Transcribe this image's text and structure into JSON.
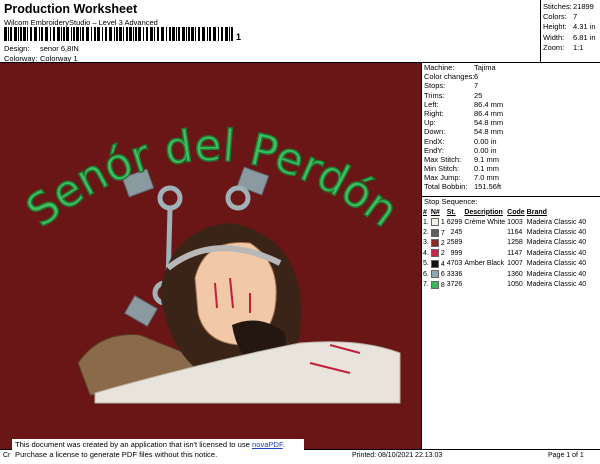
{
  "header": {
    "title": "Production Worksheet",
    "subtitle": "Wilcom EmbroideryStudio – Level 3 Advanced",
    "barcode_suffix": "1"
  },
  "design_info": [
    {
      "label": "Design:",
      "value": "senor 6,8IN"
    },
    {
      "label": "Colorway:",
      "value": "Colorway 1"
    }
  ],
  "stats": [
    {
      "label": "Stitches:",
      "value": "21899"
    },
    {
      "label": "Colors:",
      "value": "7"
    },
    {
      "label": "Height:",
      "value": "4.31 in"
    },
    {
      "label": "Width:",
      "value": "6.81 in"
    },
    {
      "label": "Zoom:",
      "value": "1:1"
    }
  ],
  "design_text": "Senór del Perdón",
  "machine_info": [
    {
      "label": "Machine:",
      "value": "Tajima"
    },
    {
      "label": "Color changes:",
      "value": "6"
    },
    {
      "label": "Stops:",
      "value": "7"
    },
    {
      "label": "Trims:",
      "value": "25"
    },
    {
      "label": "Left:",
      "value": "86.4 mm"
    },
    {
      "label": "Right:",
      "value": "86.4 mm"
    },
    {
      "label": "Up:",
      "value": "54.8 mm"
    },
    {
      "label": "Down:",
      "value": "54.8 mm"
    },
    {
      "label": "EndX:",
      "value": "0.00 in"
    },
    {
      "label": "EndY:",
      "value": "0.00 in"
    },
    {
      "label": "Max Stitch:",
      "value": "9.1 mm"
    },
    {
      "label": "Min Stitch:",
      "value": "0.1 mm"
    },
    {
      "label": "Max Jump:",
      "value": "7.0 mm"
    },
    {
      "label": "Total Bobbin:",
      "value": "151.56ft"
    }
  ],
  "sequence": {
    "title": "Stop Sequence:",
    "headers": [
      "#",
      "N#",
      "St.",
      "Description",
      "Code",
      "Brand"
    ],
    "rows": [
      {
        "n": "1.",
        "nn": "1",
        "color": "#f4f2ea",
        "st": "6299",
        "desc": "Crème White",
        "code": "1003",
        "brand": "Madeira Classic 40"
      },
      {
        "n": "2.",
        "nn": "7",
        "color": "#5e5e5e",
        "st": "245",
        "desc": "",
        "code": "1164",
        "brand": "Madeira Classic 40"
      },
      {
        "n": "3.",
        "nn": "2",
        "color": "#8a2a2a",
        "st": "2589",
        "desc": "",
        "code": "1258",
        "brand": "Madeira Classic 40"
      },
      {
        "n": "4.",
        "nn": "2",
        "color": "#c8244a",
        "st": "999",
        "desc": "",
        "code": "1147",
        "brand": "Madeira Classic 40"
      },
      {
        "n": "5.",
        "nn": "4",
        "color": "#111111",
        "st": "4703",
        "desc": "Amber Black",
        "code": "1007",
        "brand": "Madeira Classic 40"
      },
      {
        "n": "6.",
        "nn": "6",
        "color": "#8ea8b0",
        "st": "3336",
        "desc": "",
        "code": "1360",
        "brand": "Madeira Classic 40"
      },
      {
        "n": "7.",
        "nn": "8",
        "color": "#3ab35a",
        "st": "3726",
        "desc": "",
        "code": "1050",
        "brand": "Madeira Classic 40"
      }
    ]
  },
  "notice": {
    "line1_pre": "This document was created by an application that isn't licensed to use ",
    "link": "novaPDF",
    "line1_post": ".",
    "line2": "Purchase a license to generate PDF files without this notice."
  },
  "footer": {
    "left": "Cr",
    "printed": "Printed: 08/10/2021 22.13.03",
    "page": "Page 1 of 1"
  }
}
